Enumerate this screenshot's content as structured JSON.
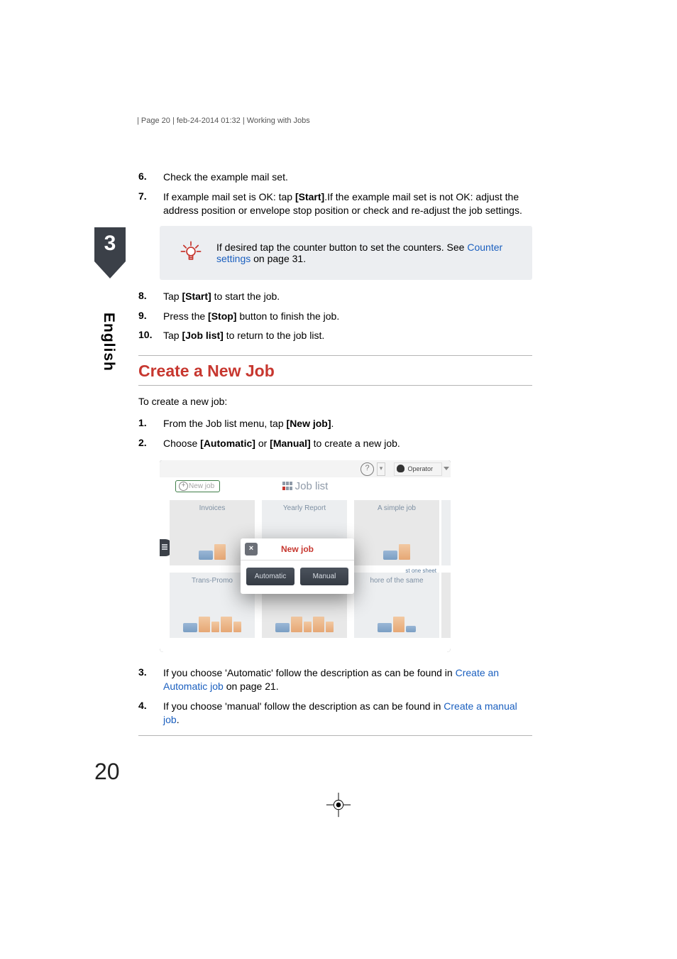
{
  "header": {
    "text": "| Page 20 | feb-24-2014 01:32 | Working with Jobs"
  },
  "chapter": {
    "num": "3",
    "lang": "English"
  },
  "steps_a": [
    {
      "n": "6.",
      "plain": "Check the example mail set."
    },
    {
      "n": "7.",
      "pre": "If example mail set is OK: tap ",
      "bold": "[Start]",
      "post": ".If the example mail set is not OK: adjust the address position or envelope stop position or check and re-adjust the job settings."
    }
  ],
  "callout": {
    "pre": "If desired tap the counter button to set the counters. See ",
    "link": "Counter settings",
    "post": " on page 31."
  },
  "steps_b": [
    {
      "n": "8.",
      "pre": "Tap ",
      "bold": "[Start]",
      "post": " to start the job."
    },
    {
      "n": "9.",
      "pre": "Press the ",
      "bold": "[Stop]",
      "post": " button to finish the job."
    },
    {
      "n": "10.",
      "pre": "Tap ",
      "bold": "[Job list]",
      "post": " to return to the job list."
    }
  ],
  "section": {
    "title": "Create a New Job",
    "intro": "To create a new job:"
  },
  "steps_c": [
    {
      "n": "1.",
      "pre": "From the Job list menu, tap ",
      "bold": "[New job]",
      "post": "."
    },
    {
      "n": "2.",
      "pre": "Choose ",
      "bold": "[Automatic]",
      "mid": " or ",
      "bold2": "[Manual]",
      "post": " to create a new job."
    }
  ],
  "screenshot": {
    "operator": "Operator",
    "newjob_btn": "New job",
    "title": "Job list",
    "cards": {
      "r1": [
        "Invoices",
        "Yearly Report",
        "A simple job"
      ],
      "r2": [
        "Trans-Promo",
        "",
        "hore of the same"
      ],
      "r1_edge_sub": "st one sheet"
    },
    "modal": {
      "title": "New job",
      "close": "×",
      "auto": "Automatic",
      "manual": "Manual"
    }
  },
  "steps_d": [
    {
      "n": "3.",
      "pre": "If you choose 'Automatic' follow the description as can be found in ",
      "link": "Create an Automatic job",
      "post": " on page 21."
    },
    {
      "n": "4.",
      "pre": "If you choose 'manual' follow the description as can be found in ",
      "link": "Create a manual job",
      "post": "."
    }
  ],
  "pagenum": "20"
}
